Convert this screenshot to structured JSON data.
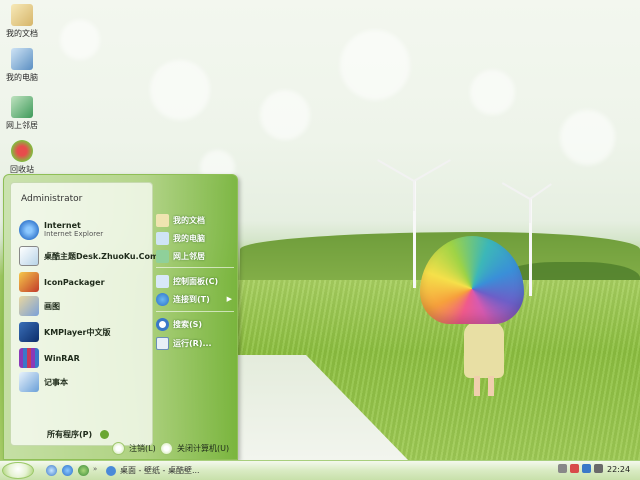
{
  "desktop": {
    "icons": [
      {
        "label": "我的文档",
        "icon": "my-documents-icon"
      },
      {
        "label": "我的电脑",
        "icon": "my-computer-icon"
      },
      {
        "label": "网上邻居",
        "icon": "network-places-icon"
      },
      {
        "label": "回收站",
        "icon": "recycle-bin-icon"
      }
    ]
  },
  "start_menu": {
    "user": "Administrator",
    "programs": [
      {
        "label": "Internet",
        "sublabel": "Internet Explorer",
        "icon": "internet-explorer-icon"
      },
      {
        "label": "桌酷主题Desk.ZhuoKu.Com",
        "icon": "zhuoku-theme-icon"
      },
      {
        "label": "IconPackager",
        "icon": "iconpackager-icon"
      },
      {
        "label": "画图",
        "icon": "paint-icon"
      },
      {
        "label": "KMPlayer中文版",
        "icon": "kmplayer-icon"
      },
      {
        "label": "WinRAR",
        "icon": "winrar-icon"
      },
      {
        "label": "记事本",
        "icon": "notepad-icon"
      }
    ],
    "all_programs": "所有程序(P)",
    "places": [
      {
        "label": "我的文档",
        "icon": "my-documents-icon"
      },
      {
        "label": "我的电脑",
        "icon": "my-computer-icon"
      },
      {
        "label": "网上邻居",
        "icon": "network-places-icon"
      },
      {
        "label": "控制面板(C)",
        "icon": "control-panel-icon"
      },
      {
        "label": "连接到(T)",
        "icon": "connect-to-icon"
      },
      {
        "label": "搜索(S)",
        "icon": "search-icon"
      },
      {
        "label": "运行(R)...",
        "icon": "run-icon"
      }
    ],
    "logoff": "注销(L)",
    "shutdown": "关闭计算机(U)"
  },
  "taskbar": {
    "active_task": "桌面 - 壁纸 - 桌酷壁...",
    "clock": "22:24"
  },
  "colors": {
    "accent": "#8fbf56",
    "menu_text_light": "#ffffff"
  }
}
